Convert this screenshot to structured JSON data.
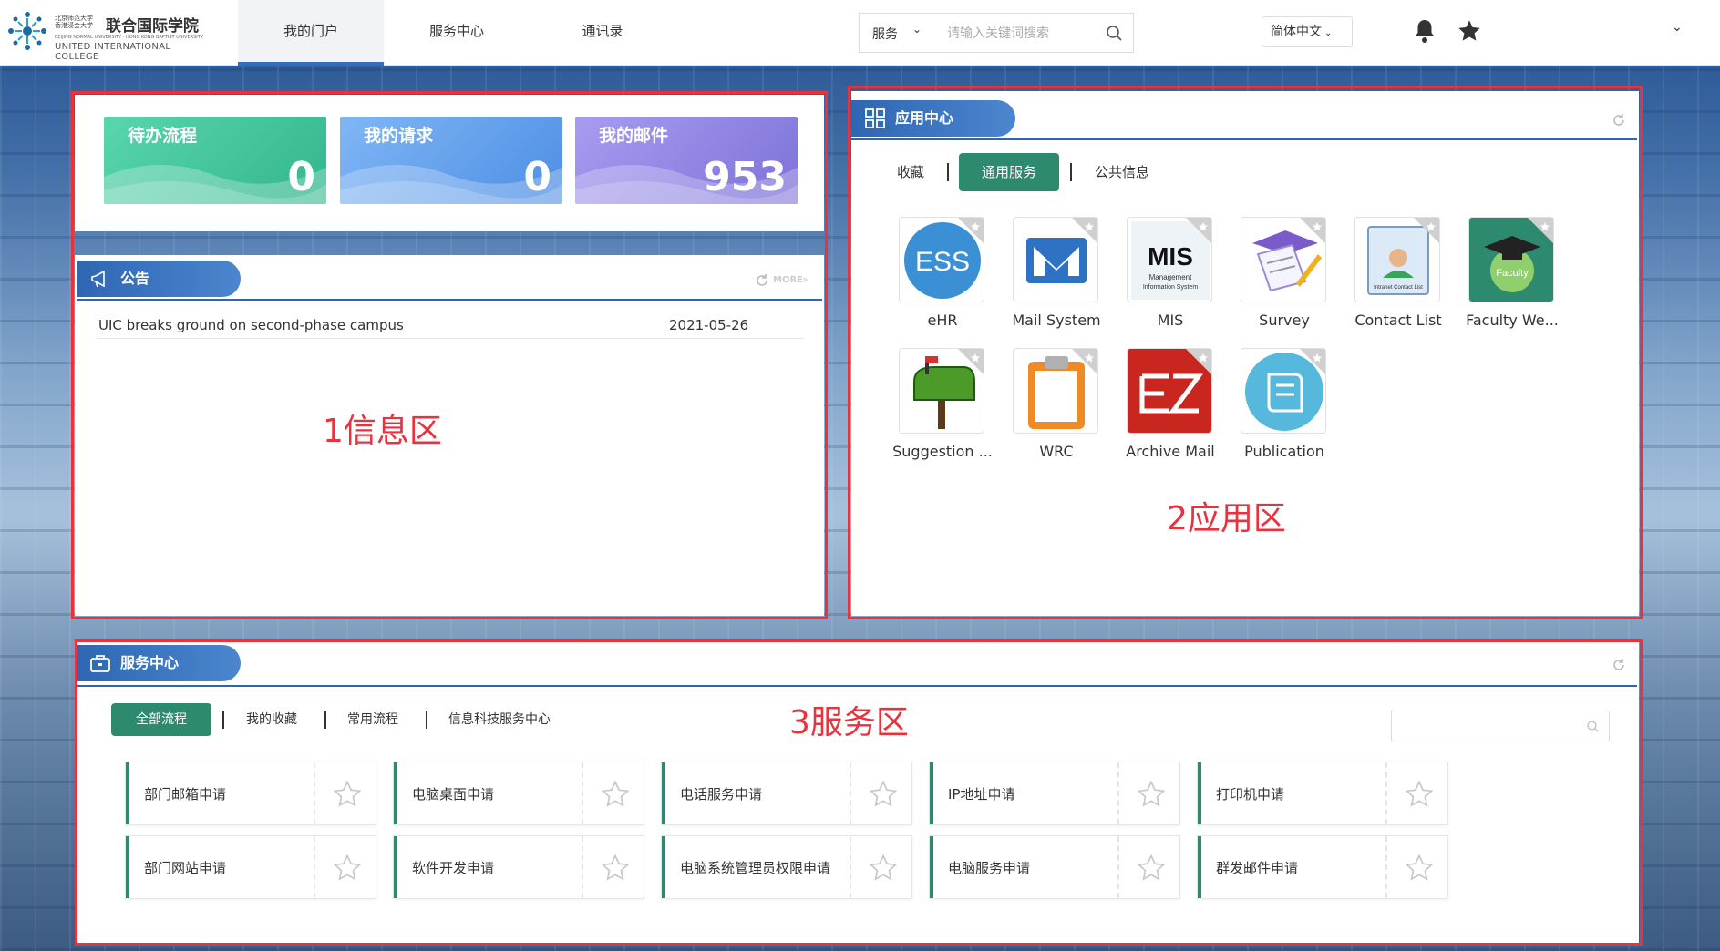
{
  "header": {
    "logo": {
      "cn_univ_line1": "北京师范大学",
      "cn_univ_line2": "香港浸会大学",
      "cn_name": "联合国际学院",
      "en_small": "BEIJING NORMAL UNIVERSITY · HONG KONG BAPTIST UNIVERSITY",
      "en_name": "UNITED INTERNATIONAL COLLEGE"
    },
    "nav_tabs": [
      {
        "label": "我的门户",
        "active": true
      },
      {
        "label": "服务中心",
        "active": false
      },
      {
        "label": "通讯录",
        "active": false
      }
    ],
    "search": {
      "category": "服务",
      "placeholder": "请输入关键词搜索"
    },
    "language": "简体中文",
    "icons": [
      "bell-icon",
      "star-icon",
      "chevron-down-icon"
    ]
  },
  "info_area": {
    "stats": [
      {
        "title": "待办流程",
        "value": "0",
        "color": "#3cc49a"
      },
      {
        "title": "我的请求",
        "value": "0",
        "color": "#5a9bea"
      },
      {
        "title": "我的邮件",
        "value": "953",
        "color": "#8e86e0"
      }
    ],
    "notice": {
      "title": "公告",
      "more": "MORE",
      "items": [
        {
          "title": "UIC breaks ground on second-phase campus",
          "date": "2021-05-26"
        }
      ]
    },
    "zone_label": "1信息区"
  },
  "app_area": {
    "title": "应用中心",
    "tabs": [
      {
        "label": "收藏",
        "active": false
      },
      {
        "label": "通用服务",
        "active": true
      },
      {
        "label": "公共信息",
        "active": false
      }
    ],
    "apps": [
      {
        "name": "eHR",
        "icon": "ess-icon"
      },
      {
        "name": "Mail System",
        "icon": "mail-icon"
      },
      {
        "name": "MIS",
        "icon": "mis-icon"
      },
      {
        "name": "Survey",
        "icon": "survey-icon"
      },
      {
        "name": "Contact List",
        "icon": "contact-list-icon"
      },
      {
        "name": "Faculty We...",
        "icon": "faculty-icon"
      },
      {
        "name": "Suggestion ...",
        "icon": "mailbox-icon"
      },
      {
        "name": "WRC",
        "icon": "clipboard-icon"
      },
      {
        "name": "Archive Mail",
        "icon": "archive-mail-icon"
      },
      {
        "name": "Publication",
        "icon": "book-icon"
      }
    ],
    "mis_caption1": "Management",
    "mis_caption2": "Information System",
    "contact_caption": "Intranet Contact List",
    "faculty_caption": "Faculty",
    "zone_label": "2应用区"
  },
  "service_area": {
    "title": "服务中心",
    "tabs": [
      {
        "label": "全部流程",
        "active": true
      },
      {
        "label": "我的收藏",
        "active": false
      },
      {
        "label": "常用流程",
        "active": false
      },
      {
        "label": "信息科技服务中心",
        "active": false
      }
    ],
    "search_placeholder": "",
    "services": [
      "部门邮箱申请",
      "电脑桌面申请",
      "电话服务申请",
      "IP地址申请",
      "打印机申请",
      "部门网站申请",
      "软件开发申请",
      "电脑系统管理员权限申请",
      "电脑服务申请",
      "群发邮件申请"
    ],
    "zone_label": "3服务区"
  }
}
